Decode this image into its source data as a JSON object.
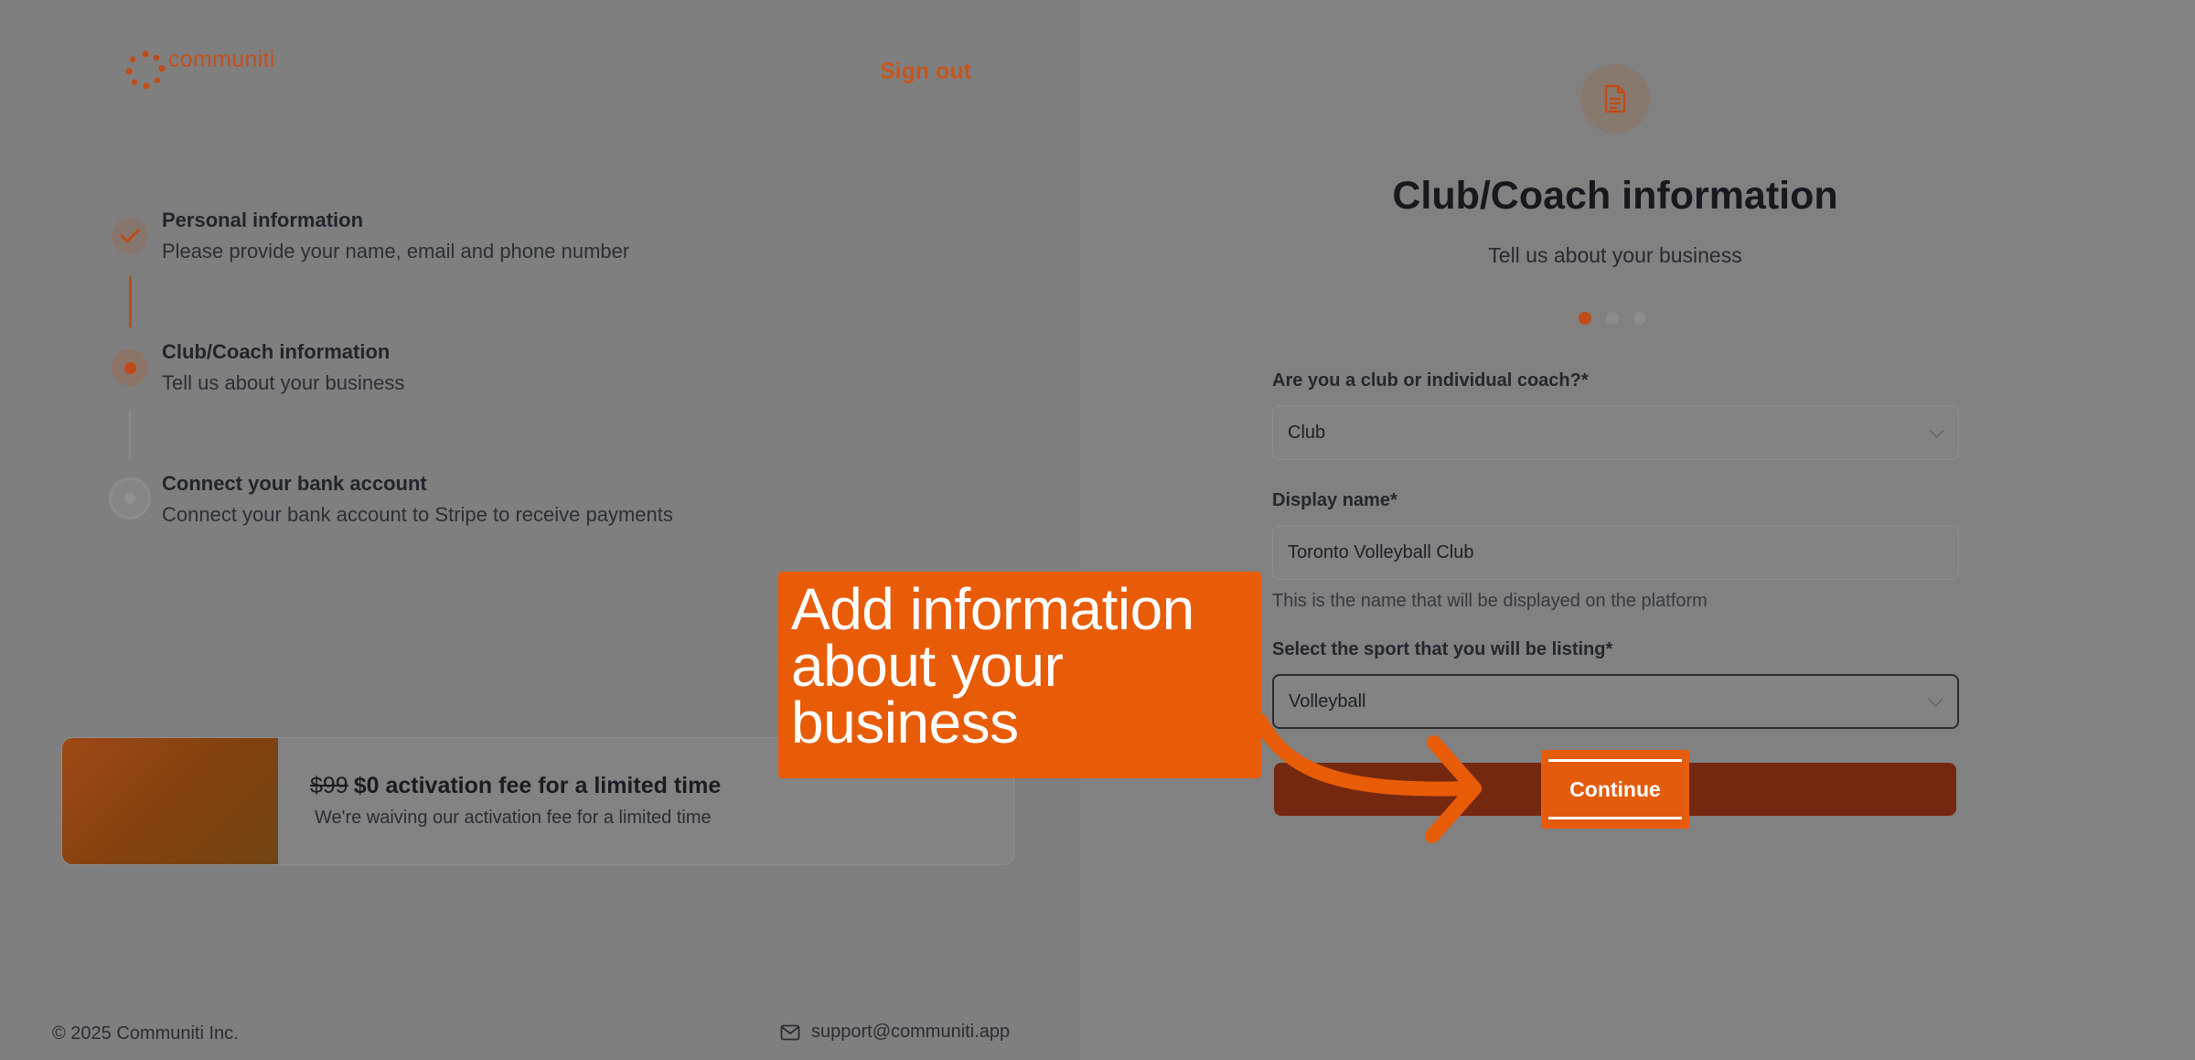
{
  "brand": {
    "name": "communiti",
    "accent": "#c4501e"
  },
  "header": {
    "sign_out": "Sign out"
  },
  "steps": [
    {
      "title": "Personal information",
      "description": "Please provide your name, email and phone number",
      "state": "done"
    },
    {
      "title": "Club/Coach information",
      "description": "Tell us about your business",
      "state": "active"
    },
    {
      "title": "Connect your bank account",
      "description": "Connect your bank account to Stripe to receive payments",
      "state": "todo"
    }
  ],
  "promo": {
    "old_price": "$99",
    "title": "$0 activation fee for a limited time",
    "subtitle": "We're waiving our activation fee for a limited time"
  },
  "footer": {
    "copyright": "© 2025 Communiti Inc.",
    "support_email": "support@communiti.app"
  },
  "form": {
    "title": "Club/Coach information",
    "subtitle": "Tell us about your business",
    "progress": {
      "current": 1,
      "total": 3
    },
    "type_label": "Are you a club or individual coach?*",
    "type_value": "Club",
    "display_name_label": "Display name*",
    "display_name_value": "Toronto Volleyball Club",
    "display_name_hint": "This is the name that will be displayed on the platform",
    "sport_label": "Select the sport that you will be listing*",
    "sport_value": "Volleyball",
    "continue_label": "Continue"
  },
  "callout": {
    "text": "Add information about your business",
    "color": "#e85c08"
  }
}
